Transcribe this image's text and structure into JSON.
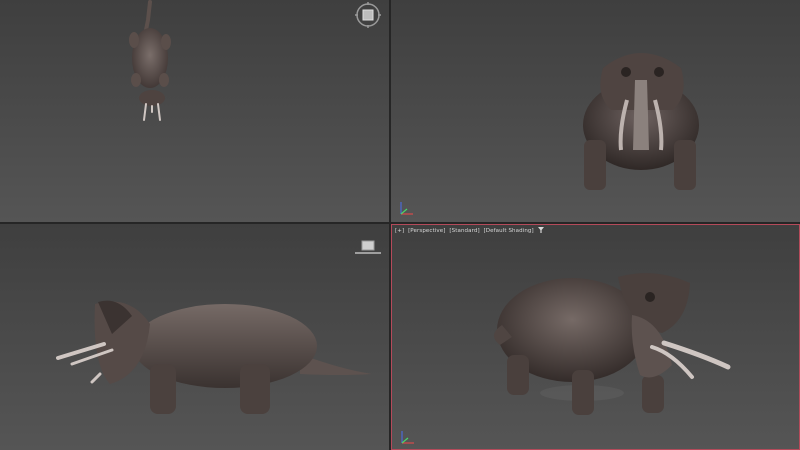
{
  "app": {
    "name": "3D viewport layout"
  },
  "viewports": {
    "perspective": {
      "label_parts": [
        "[+]",
        "[Perspective]",
        "[Standard]",
        "[Default Shading]"
      ],
      "filter_icon": "funnel-icon",
      "active": true
    }
  },
  "icons": {
    "top_viewcube": "viewcube-icon",
    "left_viewcube": "viewcube-icon",
    "front_axis": "axis-tripod-icon",
    "perspective_axis": "axis-tripod-icon"
  },
  "colors": {
    "active_border": "#b54a5a",
    "viewport_bg": "#474747",
    "model": "#6b5e5a"
  }
}
